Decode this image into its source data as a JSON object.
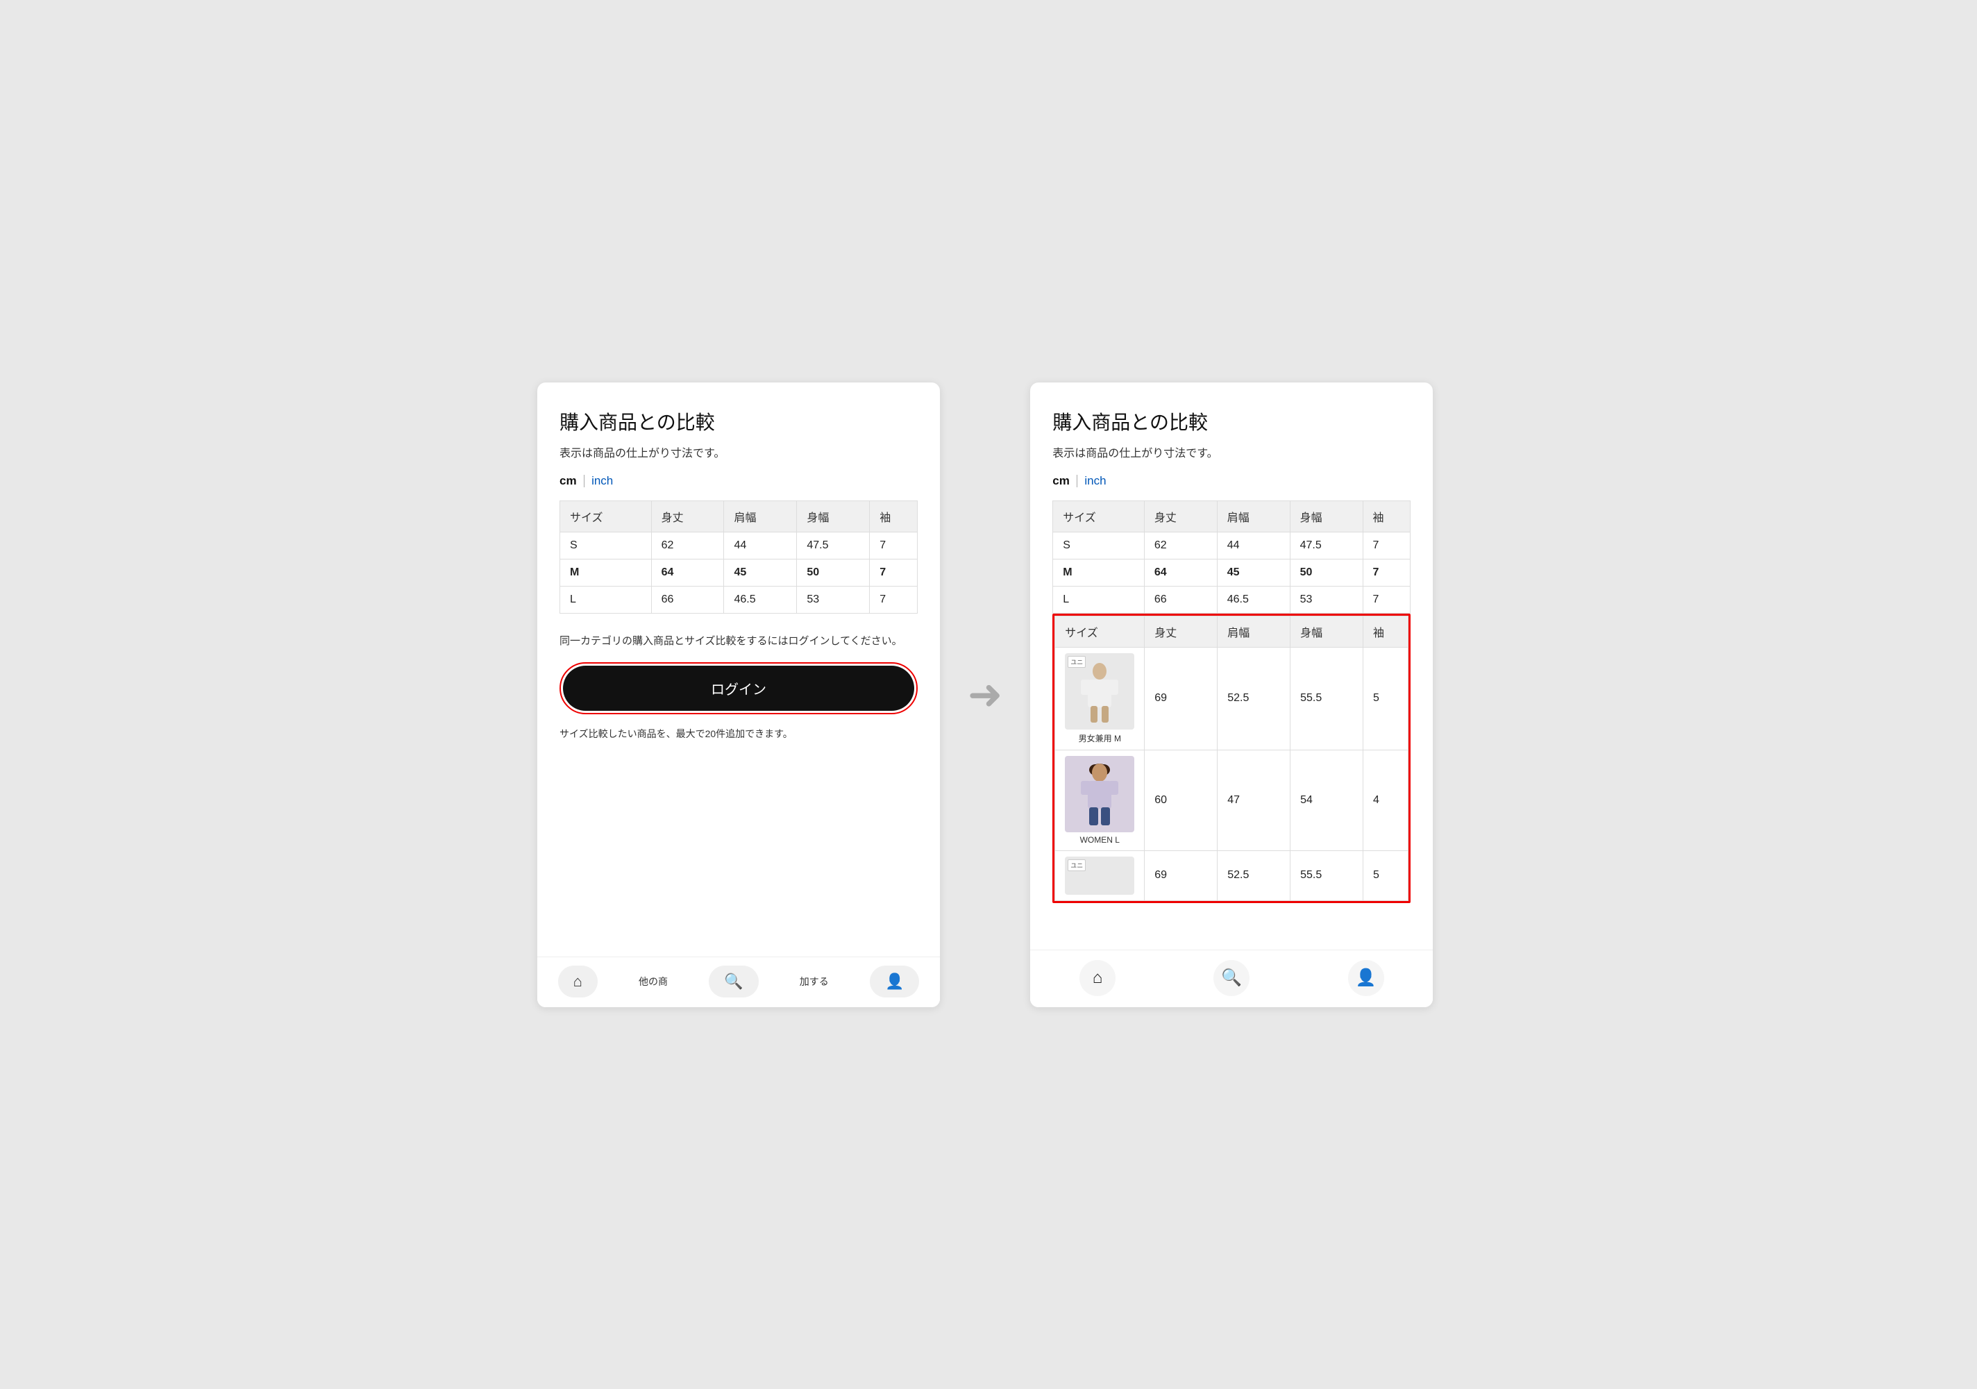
{
  "left_phone": {
    "title": "購入商品との比較",
    "subtitle": "表示は商品の仕上がり寸法です。",
    "unit_cm": "cm",
    "unit_inch": "inch",
    "table": {
      "headers": [
        "サイズ",
        "身丈",
        "肩幅",
        "身幅",
        "袖"
      ],
      "rows": [
        {
          "size": "S",
          "body_length": "62",
          "shoulder": "44",
          "width": "47.5",
          "sleeve": "7",
          "highlight": false
        },
        {
          "size": "M",
          "body_length": "64",
          "shoulder": "45",
          "width": "50",
          "sleeve": "7",
          "highlight": true
        },
        {
          "size": "L",
          "body_length": "66",
          "shoulder": "46.5",
          "width": "53",
          "sleeve": "7",
          "highlight": false
        }
      ]
    },
    "login_text": "同一カテゴリの購入商品とサイズ比較をするにはログインしてください。",
    "login_button": "ログイン",
    "bottom_text": "サイズ比較したい商品を、最大で20件追加できます。",
    "nav": {
      "home_label": "",
      "other_label": "他の商",
      "add_label": "加する",
      "profile_label": ""
    }
  },
  "right_phone": {
    "title": "購入商品との比較",
    "subtitle": "表示は商品の仕上がり寸法です。",
    "unit_cm": "cm",
    "unit_inch": "inch",
    "table": {
      "headers": [
        "サイズ",
        "身丈",
        "肩幅",
        "身幅",
        "袖"
      ],
      "rows": [
        {
          "size": "S",
          "body_length": "62",
          "shoulder": "44",
          "width": "47.5",
          "sleeve": "7",
          "highlight": false
        },
        {
          "size": "M",
          "body_length": "64",
          "shoulder": "45",
          "width": "50",
          "sleeve": "7",
          "highlight": true
        },
        {
          "size": "L",
          "body_length": "66",
          "shoulder": "46.5",
          "width": "53",
          "sleeve": "7",
          "highlight": false
        }
      ]
    },
    "comparison": {
      "headers": [
        "サイズ",
        "身丈",
        "肩幅",
        "身幅",
        "袖"
      ],
      "rows": [
        {
          "image_label": "男女兼用 M",
          "image_bg": "white_tshirt",
          "body_length": "69",
          "shoulder": "52.5",
          "width": "55.5",
          "sleeve": "5",
          "badge": "ユニ"
        },
        {
          "image_label": "WOMEN L",
          "image_bg": "lavender_tshirt",
          "body_length": "60",
          "shoulder": "47",
          "width": "54",
          "sleeve": "4",
          "badge": ""
        },
        {
          "image_label": "",
          "image_bg": "third_item",
          "body_length": "69",
          "shoulder": "52.5",
          "width": "55.5",
          "sleeve": "5",
          "badge": "ユニ"
        }
      ]
    }
  },
  "arrow": "→"
}
